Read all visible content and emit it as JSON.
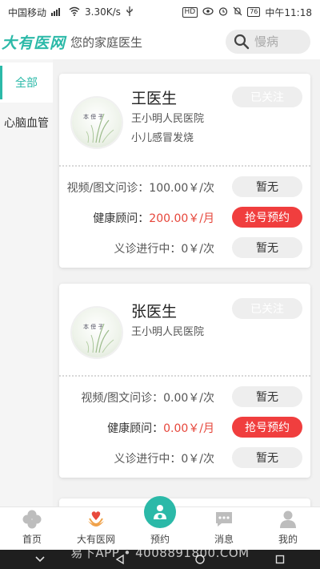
{
  "status_bar": {
    "carrier": "中国移动",
    "network_speed": "3.30K/s",
    "hd_badge": "HD",
    "battery": "76",
    "time": "中午11:18"
  },
  "header": {
    "logo": "大有医网",
    "slogan": "您的家庭医生",
    "search_placeholder": "慢病"
  },
  "sidebar": {
    "categories": [
      {
        "label": "全部",
        "active": true
      },
      {
        "label": "心脑血管",
        "active": false
      }
    ]
  },
  "doctors": [
    {
      "name": "王医生",
      "hospital": "王小明人民医院",
      "specialty": "小儿感冒发烧",
      "follow_label": "已关注",
      "services": [
        {
          "title": "视频/图文问诊：",
          "price": "100.00￥/次",
          "button": "暂无",
          "highlight": false
        },
        {
          "title": "健康顾问：",
          "price": "200.00￥/月",
          "button": "抢号预约",
          "highlight": true
        },
        {
          "title": "义诊进行中：",
          "price": "0￥/次",
          "button": "暂无",
          "highlight": false
        }
      ]
    },
    {
      "name": "张医生",
      "hospital": "王小明人民医院",
      "specialty": "",
      "follow_label": "已关注",
      "services": [
        {
          "title": "视频/图文问诊：",
          "price": "0.00￥/次",
          "button": "暂无",
          "highlight": false
        },
        {
          "title": "健康顾问：",
          "price": "0.00￥/月",
          "button": "抢号预约",
          "highlight": true
        },
        {
          "title": "义诊进行中：",
          "price": "0￥/次",
          "button": "暂无",
          "highlight": false
        }
      ]
    }
  ],
  "tabbar": {
    "tabs": [
      {
        "label": "首页",
        "icon": "home-clover-icon"
      },
      {
        "label": "大有医网",
        "icon": "heart-hands-icon"
      },
      {
        "label": "预约",
        "icon": "doctor-icon"
      },
      {
        "label": "消息",
        "icon": "chat-bubble-icon"
      },
      {
        "label": "我的",
        "icon": "person-icon"
      }
    ]
  },
  "watermark": "易下APP • 4008891800.COM",
  "colors": {
    "accent": "#2bb9a8",
    "red": "#f03e3e",
    "price_red": "#e6453a"
  }
}
